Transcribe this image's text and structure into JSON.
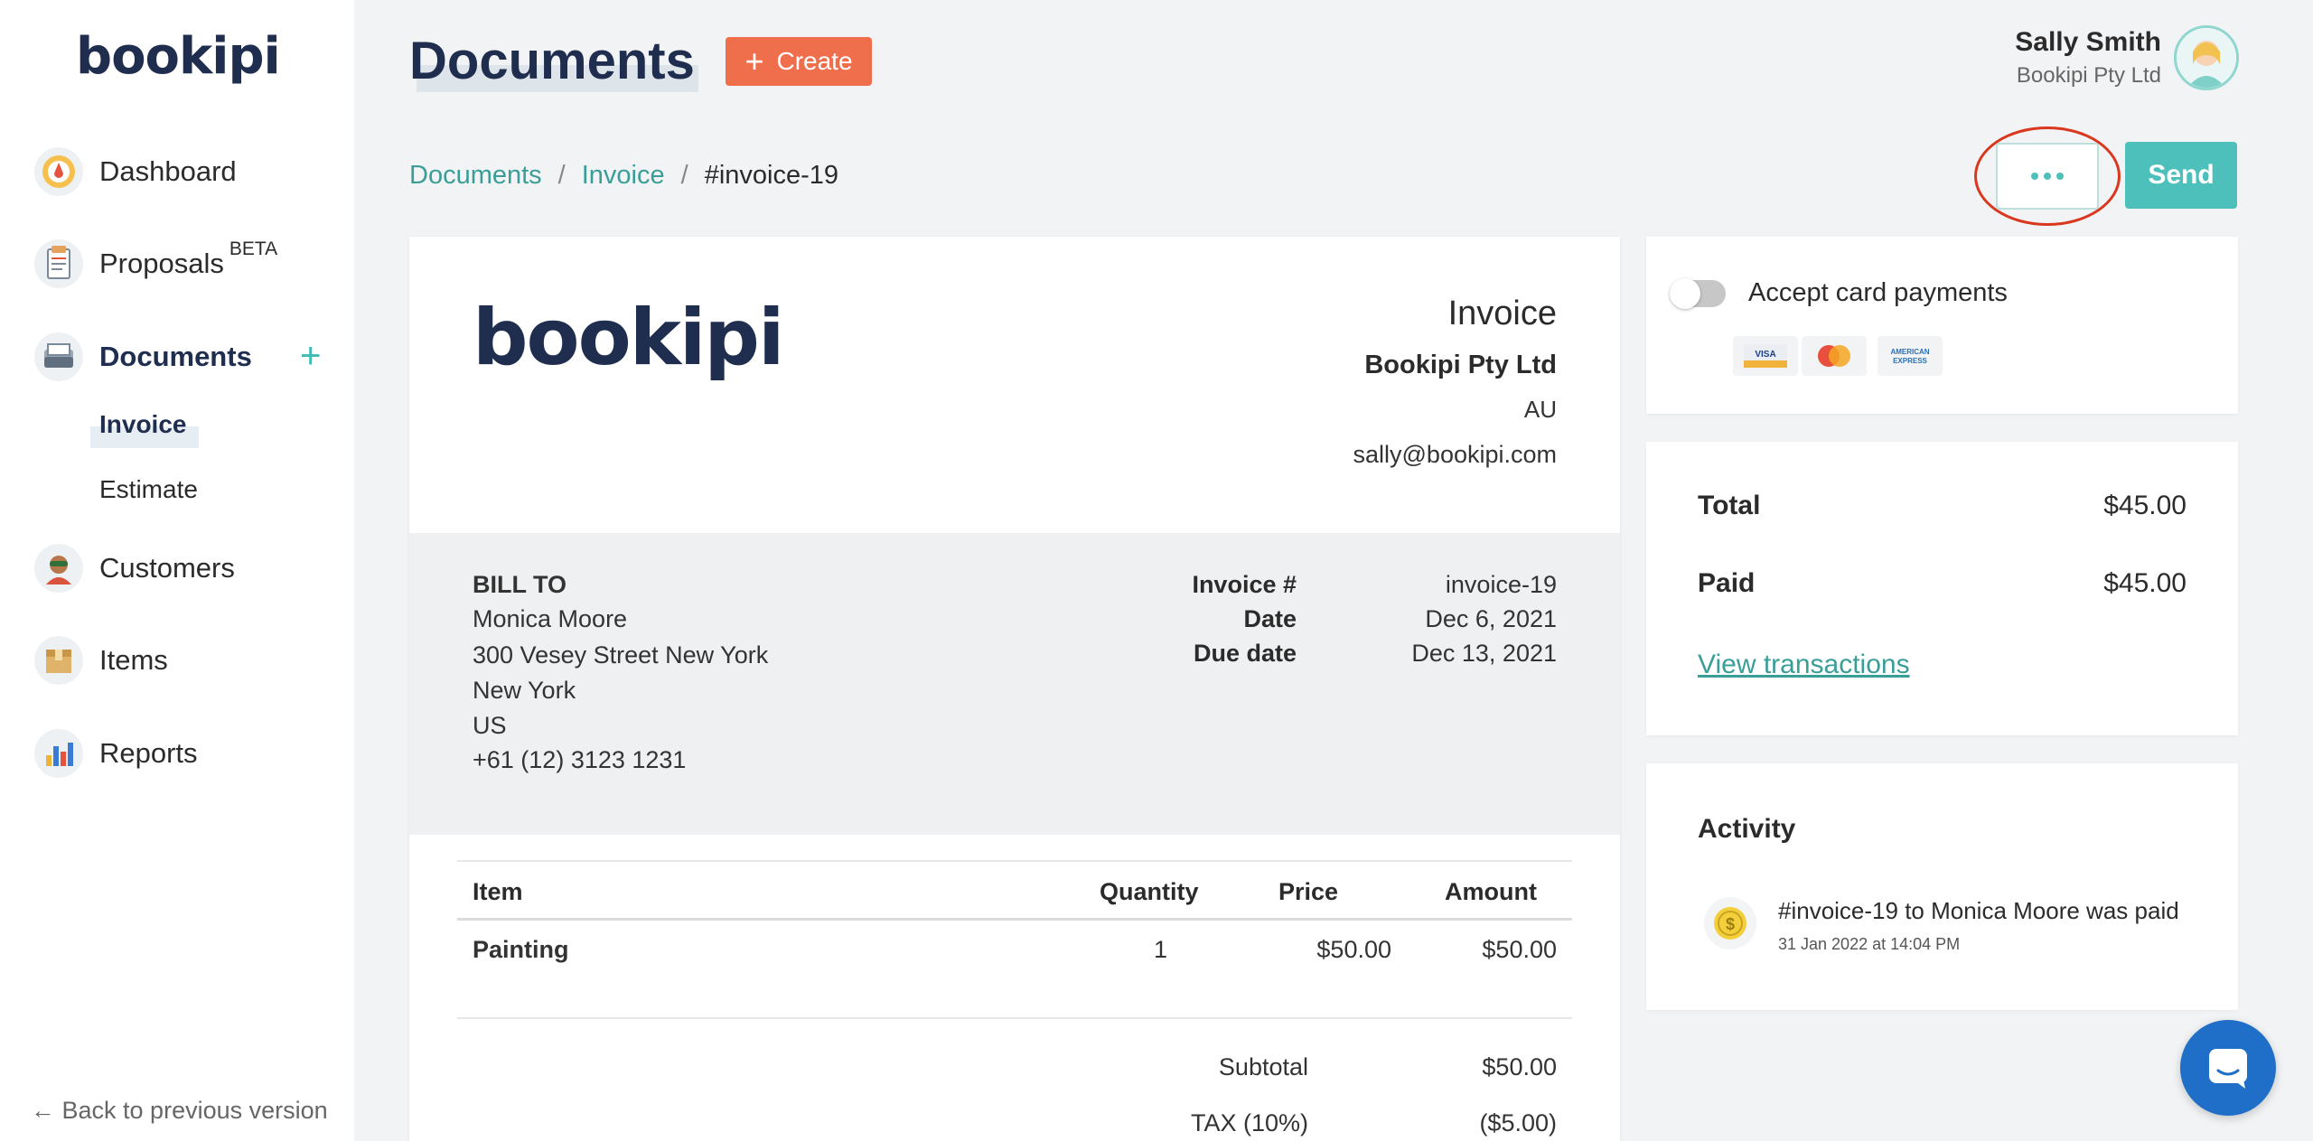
{
  "brand": {
    "name": "bookipi"
  },
  "sidebar": {
    "items": [
      {
        "label": "Dashboard",
        "icon": "dashboard-icon"
      },
      {
        "label": "Proposals",
        "badge": "BETA",
        "icon": "proposals-icon"
      },
      {
        "label": "Documents",
        "icon": "documents-icon"
      },
      {
        "label": "Customers",
        "icon": "customers-icon"
      },
      {
        "label": "Items",
        "icon": "items-icon"
      },
      {
        "label": "Reports",
        "icon": "reports-icon"
      }
    ],
    "sub_items": [
      {
        "label": "Invoice"
      },
      {
        "label": "Estimate"
      }
    ],
    "back_label": "Back to previous version"
  },
  "header": {
    "title": "Documents",
    "create_label": "Create"
  },
  "user": {
    "name": "Sally Smith",
    "company": "Bookipi Pty Ltd"
  },
  "breadcrumb": {
    "items": [
      "Documents",
      "Invoice",
      "#invoice-19"
    ]
  },
  "actions": {
    "more_label": "•••",
    "send_label": "Send"
  },
  "invoice": {
    "logo": "bookipi",
    "title": "Invoice",
    "company": "Bookipi Pty Ltd",
    "country": "AU",
    "email": "sally@bookipi.com",
    "bill_to": {
      "heading": "BILL TO",
      "lines": [
        "Monica Moore",
        "300 Vesey Street New York",
        "New York",
        "US",
        "+61 (12) 3123 1231"
      ]
    },
    "meta": [
      {
        "label": "Invoice #",
        "value": "invoice-19"
      },
      {
        "label": "Date",
        "value": "Dec 6, 2021"
      },
      {
        "label": "Due date",
        "value": "Dec 13, 2021"
      }
    ],
    "columns": [
      "Item",
      "Quantity",
      "Price",
      "Amount"
    ],
    "rows": [
      {
        "item": "Painting",
        "quantity": "1",
        "price": "$50.00",
        "amount": "$50.00"
      }
    ],
    "summary": [
      {
        "label": "Subtotal",
        "value": "$50.00"
      },
      {
        "label": "TAX (10%)",
        "value": "($5.00)"
      }
    ]
  },
  "payments_card": {
    "accept_label": "Accept card payments",
    "toggle_on": false,
    "cards": [
      "VISA",
      "MasterCard",
      "AMERICAN EXPRESS"
    ]
  },
  "totals_card": {
    "total_label": "Total",
    "total_value": "$45.00",
    "paid_label": "Paid",
    "paid_value": "$45.00",
    "view_transactions": "View transactions"
  },
  "activity": {
    "title": "Activity",
    "entries": [
      {
        "text": "#invoice-19 to Monica Moore was paid",
        "time": "31 Jan 2022 at 14:04 PM"
      }
    ]
  },
  "colors": {
    "brand_navy": "#1f2d4f",
    "accent_teal": "#4ec0bc",
    "create_orange": "#ef6e4c",
    "highlight_red": "#d9381e",
    "chat_blue": "#1f6fc8"
  }
}
